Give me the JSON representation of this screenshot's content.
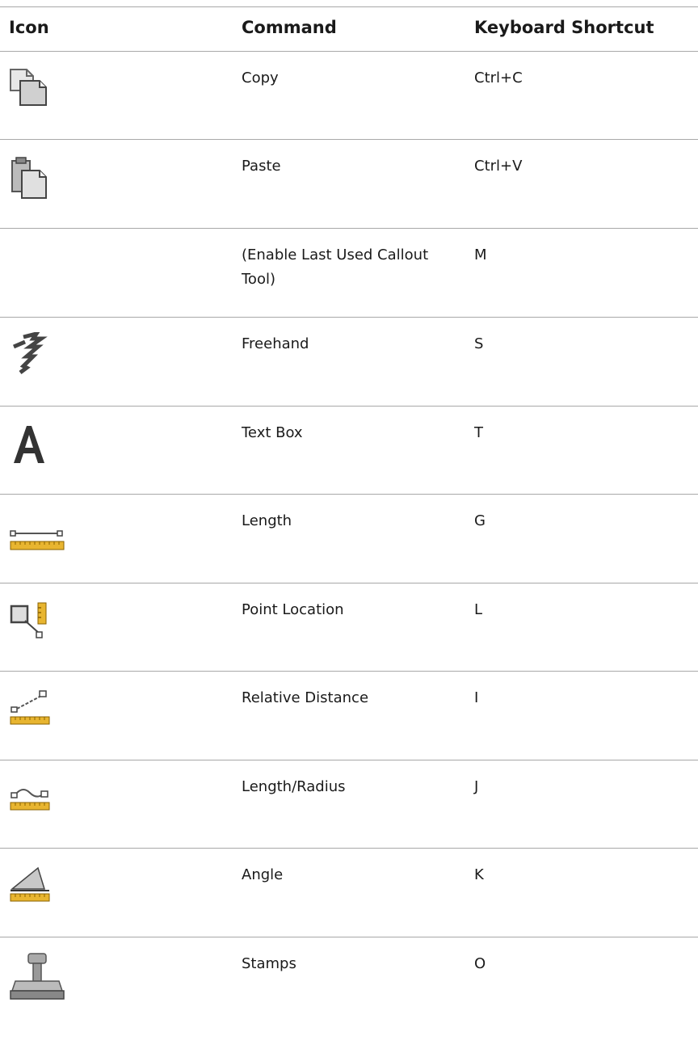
{
  "table": {
    "headers": {
      "icon": "Icon",
      "command": "Command",
      "shortcut": "Keyboard Shortcut"
    },
    "rows": [
      {
        "icon": "copy-icon",
        "command": "Copy",
        "shortcut": "Ctrl+C"
      },
      {
        "icon": "paste-icon",
        "command": "Paste",
        "shortcut": "Ctrl+V"
      },
      {
        "icon": "",
        "command": "(Enable Last Used Callout Tool)",
        "shortcut": "M"
      },
      {
        "icon": "freehand-icon",
        "command": "Freehand",
        "shortcut": "S"
      },
      {
        "icon": "text-box-icon",
        "command": "Text Box",
        "shortcut": "T"
      },
      {
        "icon": "length-icon",
        "command": "Length",
        "shortcut": "G"
      },
      {
        "icon": "point-location-icon",
        "command": "Point Location",
        "shortcut": "L"
      },
      {
        "icon": "relative-distance-icon",
        "command": "Relative Distance",
        "shortcut": "I"
      },
      {
        "icon": "length-radius-icon",
        "command": "Length/Radius",
        "shortcut": "J"
      },
      {
        "icon": "angle-icon",
        "command": "Angle",
        "shortcut": "K"
      },
      {
        "icon": "stamps-icon",
        "command": "Stamps",
        "shortcut": "O"
      }
    ]
  },
  "colors": {
    "rule": "#a8a8a8",
    "ruler_yellow": "#e8b530",
    "icon_gray": "#555555"
  }
}
